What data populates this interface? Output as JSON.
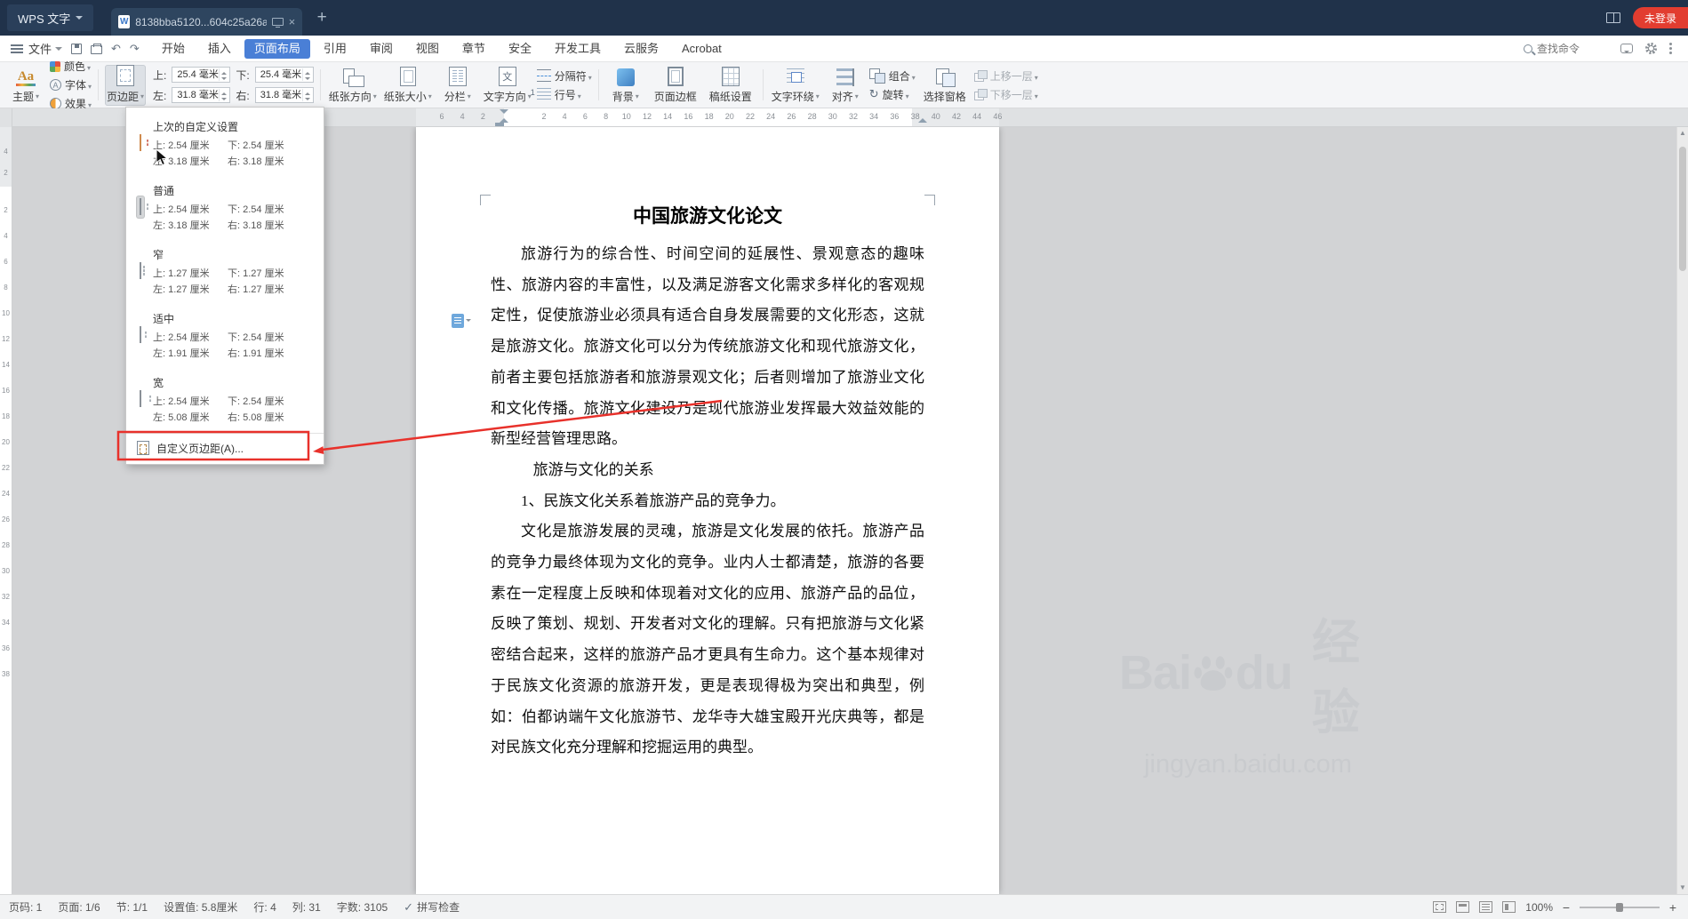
{
  "titlebar": {
    "app_button": "WPS 文字",
    "tab": {
      "title": "8138bba5120...604c25a26aa"
    },
    "login_badge": "未登录"
  },
  "menubar": {
    "file_label": "文件",
    "tabs": [
      "开始",
      "插入",
      "页面布局",
      "引用",
      "审阅",
      "视图",
      "章节",
      "安全",
      "开发工具",
      "云服务",
      "Acrobat"
    ],
    "active_tab": "页面布局",
    "search_placeholder": "查找命令"
  },
  "ribbon": {
    "theme": "主题",
    "colors": "颜色",
    "font": "字体",
    "effects": "效果",
    "margins": "页边距",
    "fields": {
      "top_label": "上:",
      "top_value": "25.4 毫米",
      "bottom_label": "下:",
      "bottom_value": "25.4 毫米",
      "left_label": "左:",
      "left_value": "31.8 毫米",
      "right_label": "右:",
      "right_value": "31.8 毫米"
    },
    "orientation": "纸张方向",
    "paper_size": "纸张大小",
    "columns": "分栏",
    "text_direction": "文字方向",
    "breaks": "分隔符",
    "line_numbers": "行号",
    "background": "背景",
    "page_border": "页面边框",
    "grid_setup": "稿纸设置",
    "text_wrap": "文字环绕",
    "align": "对齐",
    "group": "组合",
    "rotate": "旋转",
    "select_pane": "选择窗格",
    "bring_forward": "上移一层",
    "send_backward": "下移一层"
  },
  "margins_menu": {
    "items": [
      {
        "name": "上次的自定义设置",
        "top": "上: 2.54 厘米",
        "bottom": "下: 2.54 厘米",
        "left": "左: 3.18 厘米",
        "right": "右: 3.18 厘米"
      },
      {
        "name": "普通",
        "top": "上: 2.54 厘米",
        "bottom": "下: 2.54 厘米",
        "left": "左: 3.18 厘米",
        "right": "右: 3.18 厘米"
      },
      {
        "name": "窄",
        "top": "上: 1.27 厘米",
        "bottom": "下: 1.27 厘米",
        "left": "左: 1.27 厘米",
        "right": "右: 1.27 厘米"
      },
      {
        "name": "适中",
        "top": "上: 2.54 厘米",
        "bottom": "下: 2.54 厘米",
        "left": "左: 1.91 厘米",
        "right": "右: 1.91 厘米"
      },
      {
        "name": "宽",
        "top": "上: 2.54 厘米",
        "bottom": "下: 2.54 厘米",
        "left": "左: 5.08 厘米",
        "right": "右: 5.08 厘米"
      }
    ],
    "custom_label": "自定义页边距(A)..."
  },
  "ruler": {
    "horizontal": [
      "6",
      "4",
      "2",
      "2",
      "4",
      "6",
      "8",
      "10",
      "12",
      "14",
      "16",
      "18",
      "20",
      "22",
      "24",
      "26",
      "28",
      "30",
      "32",
      "34",
      "36",
      "38",
      "40",
      "42",
      "44",
      "46"
    ],
    "vertical": [
      "4",
      "2",
      "2",
      "4",
      "6",
      "8",
      "10",
      "12",
      "14",
      "16",
      "18",
      "20",
      "22",
      "24",
      "26",
      "28",
      "30",
      "32",
      "34",
      "36",
      "38"
    ]
  },
  "document": {
    "title": "中国旅游文化论文",
    "paragraphs": [
      "旅游行为的综合性、时间空间的延展性、景观意态的趣味性、旅游内容的丰富性，以及满足游客文化需求多样化的客观规定性，促使旅游业必须具有适合自身发展需要的文化形态，这就是旅游文化。旅游文化可以分为传统旅游文化和现代旅游文化，前者主要包括旅游者和旅游景观文化；后者则增加了旅游业文化和文化传播。旅游文化建设乃是现代旅游业发挥最大效益效能的新型经营管理思路。",
      "旅游与文化的关系",
      "1、民族文化关系着旅游产品的竞争力。",
      "文化是旅游发展的灵魂，旅游是文化发展的依托。旅游产品的竞争力最终体现为文化的竞争。业内人士都清楚，旅游的各要素在一定程度上反映和体现着对文化的应用、旅游产品的品位，反映了策划、规划、开发者对文化的理解。只有把旅游与文化紧密结合起来，这样的旅游产品才更具有生命力。这个基本规律对于民族文化资源的旅游开发，更是表现得极为突出和典型，例如：伯都讷端午文化旅游节、龙华寺大雄宝殿开光庆典等，都是对民族文化充分理解和挖掘运用的典型。"
    ]
  },
  "watermark": {
    "brand_left": "Bai",
    "brand_right": "du",
    "brand_cn": "经验",
    "site": "jingyan.baidu.com"
  },
  "statusbar": {
    "page_no": "页码: 1",
    "page": "页面: 1/6",
    "section": "节: 1/1",
    "setting": "设置值: 5.8厘米",
    "line": "行: 4",
    "column": "列: 31",
    "words": "字数: 3105",
    "spellcheck": "拼写检查",
    "zoom": "100%"
  },
  "icons": {
    "plus": "+",
    "close": "×",
    "undo": "↶",
    "redo": "↷",
    "check": "✓",
    "minus": "−",
    "rotate": "↻",
    "scroll_up": "▲",
    "scroll_down": "▼"
  },
  "colors": {
    "annotation": "#e8312b",
    "accent_blue": "#4a7fd6",
    "badge_red": "#e23d30"
  }
}
